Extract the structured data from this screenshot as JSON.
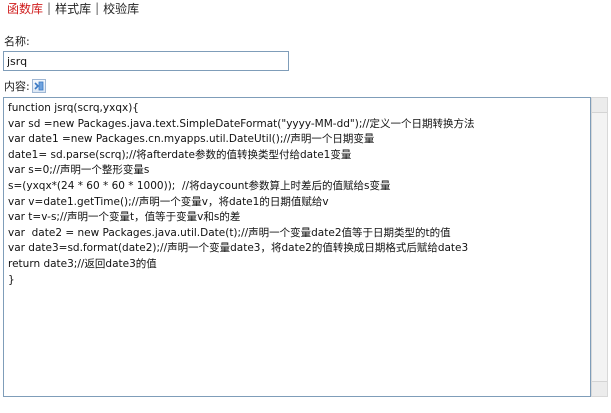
{
  "tabs": [
    {
      "label": "函数库",
      "active": true
    },
    {
      "label": "样式库",
      "active": false
    },
    {
      "label": "校验库",
      "active": false
    }
  ],
  "tab_separator": "|",
  "form": {
    "name_label": "名称:",
    "name_value": "jsrq",
    "content_label": "内容:",
    "insert_icon": "insert-function-icon"
  },
  "code_lines": [
    "function jsrq(scrq,yxqx){",
    "var sd =new Packages.java.text.SimpleDateFormat(\"yyyy-MM-dd\");//定义一个日期转换方法",
    "var date1 =new Packages.cn.myapps.util.DateUtil();//声明一个日期变量",
    "date1= sd.parse(scrq);//将afterdate参数的值转换类型付给date1变量",
    "var s=0;//声明一个整形变量s",
    "s=(yxqx*(24 * 60 * 60 * 1000));  //将daycount参数算上时差后的值赋给s变量",
    "var v=date1.getTime();//声明一个变量v，将date1的日期值赋给v",
    "var t=v-s;//声明一个变量t，值等于变量v和s的差",
    "var  date2 = new Packages.java.util.Date(t);//声明一个变量date2值等于日期类型的t的值",
    "var date3=sd.format(date2);//声明一个变量date3，将date2的值转换成日期格式后赋给date3",
    "return date3;//返回date3的值",
    "}"
  ],
  "colors": {
    "active_tab": "#d01d1d",
    "input_border": "#7f9db9"
  }
}
